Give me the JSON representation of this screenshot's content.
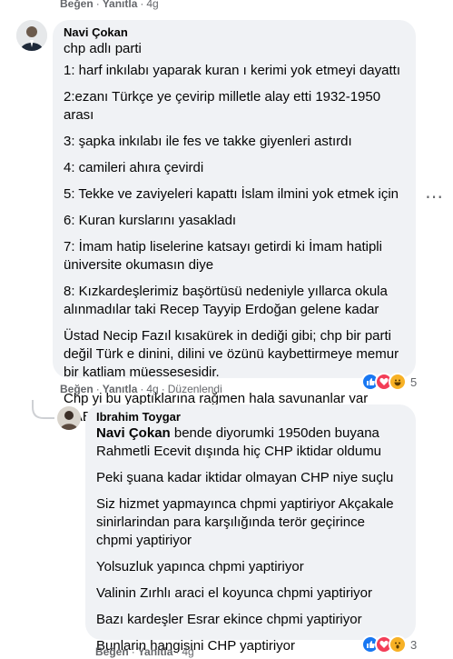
{
  "top_actions": {
    "like": "Beğen",
    "reply": "Yanıtla",
    "time": "4g"
  },
  "comment1": {
    "author": "Navi Çokan",
    "paragraphs": [
      "chp adlı parti",
      "1: harf inkılabı yaparak kuran ı kerimi yok etmeyi dayattı",
      "2:ezanı Türkçe ye çevirip milletle alay etti 1932-1950 arası",
      "3: şapka inkılabı ile fes ve takke giyenleri astırdı",
      "4: camileri ahıra çevirdi",
      "5: Tekke ve zaviyeleri kapattı İslam ilmini yok etmek için",
      "6: Kuran kurslarını yasakladı",
      "7: İmam hatip liselerine katsayı getirdi ki İmam hatipli üniversite okumasın diye",
      "8: Kızkardeşlerimiz başörtüsü nedeniyle yıllarca okula alınmadılar taki Recep Tayyip Erdoğan gelene kadar",
      "Üstad Necip Fazıl kısakürek in dediği gibi; chp bir parti değil Türk e dinini, dilini ve özünü kaybettirmeye memur bir katliam müessesesidir.",
      "Chp yi bu yaptıklarına rağmen hala savunanlar var RABBİM akıl fikir versin ne diyeyim"
    ],
    "reaction_count": "5",
    "reactions": [
      "like",
      "love",
      "haha"
    ],
    "actions": {
      "like": "Beğen",
      "reply": "Yanıtla",
      "time": "4g",
      "edited": "Düzenlendi"
    }
  },
  "comment2": {
    "author": "Ibrahim Toygar",
    "mention": "Navi Çokan",
    "first_text": " bende diyorumki 1950den buyana Rahmetli Ecevit dışında hiç CHP iktidar oldumu",
    "paragraphs": [
      "Peki şuana kadar iktidar olmayan CHP niye suçlu",
      "Siz hizmet yapmayınca chpmi yaptiriyor Akçakale sinirlarindan para karşılığında terör geçirince chpmi yaptiriyor",
      "Yolsuzluk yapınca chpmi yaptiriyor",
      "Valinin Zırhlı araci el koyunca chpmi yaptiriyor",
      "Bazı kardeşler Esrar ekince chpmi yaptiriyor",
      "Bunlarin hangisini CHP yaptiriyor"
    ],
    "reaction_count": "3",
    "reactions": [
      "like",
      "love",
      "wow"
    ],
    "actions": {
      "like": "Beğen",
      "reply": "Yanıtla",
      "time": "4g"
    }
  },
  "colors": {
    "bubble": "#f0f2f5",
    "secondary_text": "#65676b",
    "like": "#1877f2",
    "love": "#f33e58",
    "haha": "#f7b125"
  }
}
